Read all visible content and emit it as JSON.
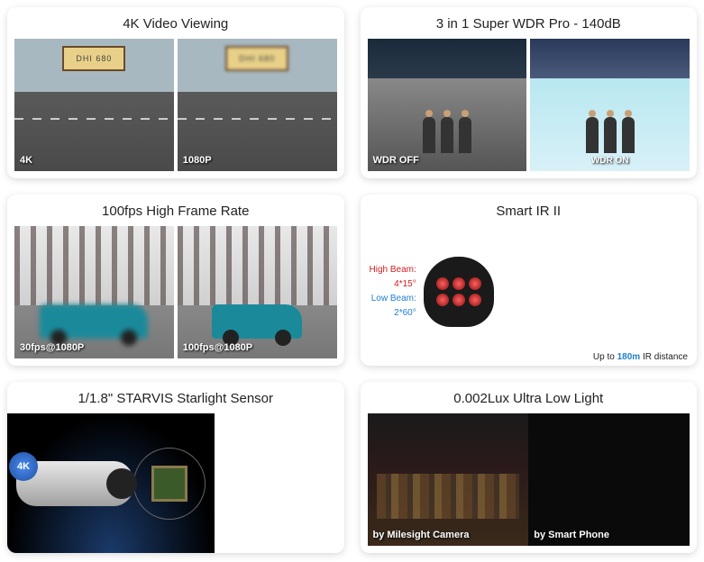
{
  "cards": [
    {
      "title": "4K Video Viewing",
      "left_label": "4K",
      "right_label": "1080P",
      "plate_text": "DHI 680"
    },
    {
      "title": "3 in 1 Super WDR Pro - 140dB",
      "left_label": "WDR OFF",
      "right_label": "WDR ON"
    },
    {
      "title": "100fps High Frame Rate",
      "left_label": "30fps@1080P",
      "right_label": "100fps@1080P"
    },
    {
      "title": "Smart IR II",
      "high_beam_label": "High Beam:",
      "high_beam_value": "4*15°",
      "low_beam_label": "Low Beam:",
      "low_beam_value": "2*60°",
      "caption_prefix": "Up to ",
      "caption_highlight": "180m",
      "caption_suffix": " IR distance"
    },
    {
      "title": "1/1.8\" STARVIS Starlight Sensor",
      "badge": "4K"
    },
    {
      "title": "0.002Lux Ultra Low Light",
      "left_label": "by Milesight Camera",
      "right_label": "by Smart Phone"
    }
  ]
}
